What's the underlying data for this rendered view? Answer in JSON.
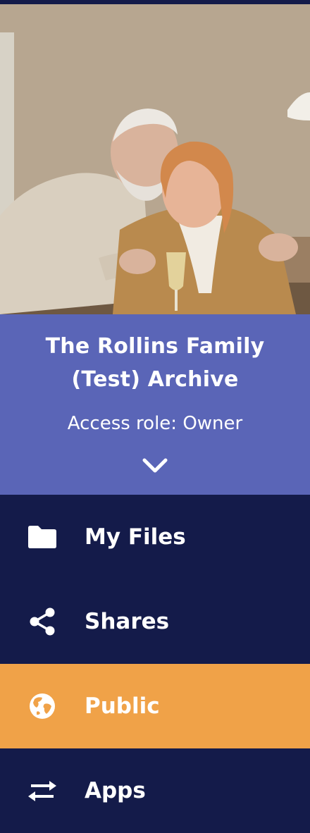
{
  "archive": {
    "name": "The Rollins Family (Test) Archive",
    "access_role": "Access role: Owner"
  },
  "nav": {
    "items": [
      {
        "label": "My Files",
        "icon": "folder-icon",
        "active": false
      },
      {
        "label": "Shares",
        "icon": "share-icon",
        "active": false
      },
      {
        "label": "Public",
        "icon": "globe-icon",
        "active": true
      },
      {
        "label": "Apps",
        "icon": "swap-arrows-icon",
        "active": false
      }
    ]
  },
  "colors": {
    "nav_background": "#141b4a",
    "archive_banner": "#5a65b7",
    "active_item": "#f0a248",
    "text": "#ffffff"
  }
}
